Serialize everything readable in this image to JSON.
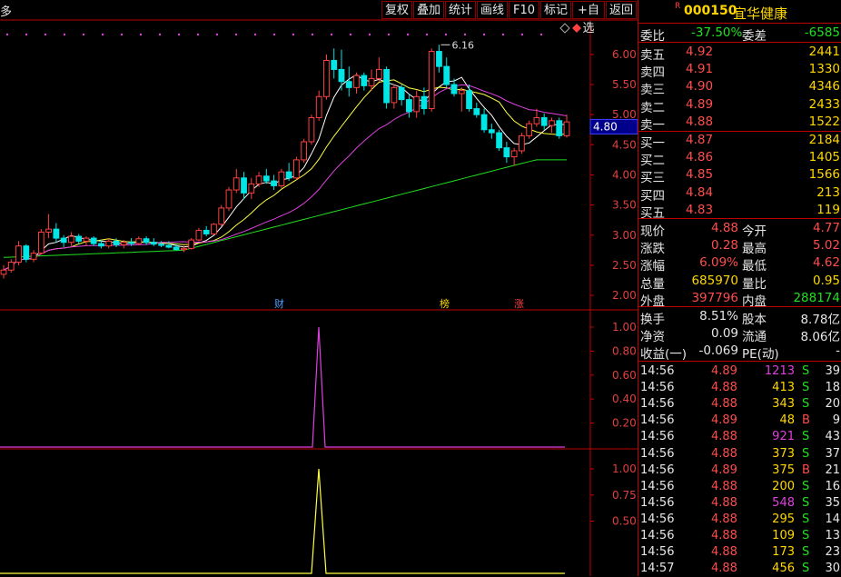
{
  "toolbar": {
    "menu_glyph": "多",
    "buttons": [
      "复权",
      "叠加",
      "统计",
      "画线",
      "F10",
      "标记",
      "+自选",
      "返回"
    ]
  },
  "chart": {
    "price_axis": [
      "6.00",
      "5.50",
      "5.00",
      "4.50",
      "4.00",
      "3.50",
      "3.00",
      "2.50",
      "2.00"
    ],
    "current_price_tag": "4.80",
    "high_label": "6.16",
    "markers": [
      "财",
      "榜",
      "涨"
    ],
    "ind1_axis": [
      "1.00",
      "0.80",
      "0.60",
      "0.40",
      "0.20"
    ],
    "ind2_axis": [
      "1.00",
      "0.75",
      "0.50"
    ],
    "colors": {
      "up": "#ff4040",
      "down": "#00e5e5",
      "ma5": "#ffffff",
      "ma10": "#ffff40",
      "ma20": "#e040e0",
      "ma60": "#20e020",
      "grid": "#c00000"
    }
  },
  "chart_data": {
    "type": "candlestick",
    "y_range": [
      1.85,
      6.3
    ],
    "candles": [
      {
        "o": 2.35,
        "h": 2.5,
        "l": 2.28,
        "c": 2.42
      },
      {
        "o": 2.42,
        "h": 2.6,
        "l": 2.38,
        "c": 2.55
      },
      {
        "o": 2.55,
        "h": 2.9,
        "l": 2.5,
        "c": 2.82
      },
      {
        "o": 2.82,
        "h": 2.85,
        "l": 2.55,
        "c": 2.6
      },
      {
        "o": 2.6,
        "h": 2.75,
        "l": 2.55,
        "c": 2.7
      },
      {
        "o": 2.7,
        "h": 3.1,
        "l": 2.68,
        "c": 3.05
      },
      {
        "o": 3.05,
        "h": 3.35,
        "l": 2.95,
        "c": 3.1
      },
      {
        "o": 3.1,
        "h": 3.2,
        "l": 2.88,
        "c": 2.95
      },
      {
        "o": 2.95,
        "h": 3.0,
        "l": 2.8,
        "c": 2.88
      },
      {
        "o": 2.88,
        "h": 3.05,
        "l": 2.82,
        "c": 2.98
      },
      {
        "o": 2.98,
        "h": 3.02,
        "l": 2.85,
        "c": 2.9
      },
      {
        "o": 2.9,
        "h": 2.98,
        "l": 2.82,
        "c": 2.95
      },
      {
        "o": 2.95,
        "h": 2.98,
        "l": 2.82,
        "c": 2.86
      },
      {
        "o": 2.86,
        "h": 2.92,
        "l": 2.78,
        "c": 2.82
      },
      {
        "o": 2.82,
        "h": 2.95,
        "l": 2.78,
        "c": 2.9
      },
      {
        "o": 2.9,
        "h": 2.95,
        "l": 2.8,
        "c": 2.84
      },
      {
        "o": 2.84,
        "h": 2.92,
        "l": 2.78,
        "c": 2.88
      },
      {
        "o": 2.88,
        "h": 2.95,
        "l": 2.82,
        "c": 2.86
      },
      {
        "o": 2.86,
        "h": 2.98,
        "l": 2.83,
        "c": 2.94
      },
      {
        "o": 2.94,
        "h": 2.98,
        "l": 2.84,
        "c": 2.88
      },
      {
        "o": 2.88,
        "h": 2.95,
        "l": 2.82,
        "c": 2.85
      },
      {
        "o": 2.85,
        "h": 2.9,
        "l": 2.8,
        "c": 2.83
      },
      {
        "o": 2.83,
        "h": 2.9,
        "l": 2.78,
        "c": 2.8
      },
      {
        "o": 2.8,
        "h": 2.86,
        "l": 2.74,
        "c": 2.76
      },
      {
        "o": 2.76,
        "h": 2.82,
        "l": 2.72,
        "c": 2.78
      },
      {
        "o": 2.78,
        "h": 2.95,
        "l": 2.76,
        "c": 2.92
      },
      {
        "o": 2.92,
        "h": 3.12,
        "l": 2.9,
        "c": 3.08
      },
      {
        "o": 3.08,
        "h": 3.15,
        "l": 2.98,
        "c": 3.02
      },
      {
        "o": 3.02,
        "h": 3.2,
        "l": 3.0,
        "c": 3.18
      },
      {
        "o": 3.18,
        "h": 3.5,
        "l": 3.15,
        "c": 3.45
      },
      {
        "o": 3.45,
        "h": 3.8,
        "l": 3.4,
        "c": 3.75
      },
      {
        "o": 3.75,
        "h": 4.1,
        "l": 3.7,
        "c": 3.95
      },
      {
        "o": 3.95,
        "h": 4.05,
        "l": 3.6,
        "c": 3.7
      },
      {
        "o": 3.7,
        "h": 3.95,
        "l": 3.6,
        "c": 3.85
      },
      {
        "o": 3.85,
        "h": 4.05,
        "l": 3.8,
        "c": 3.98
      },
      {
        "o": 3.98,
        "h": 4.1,
        "l": 3.85,
        "c": 3.9
      },
      {
        "o": 3.9,
        "h": 4.0,
        "l": 3.75,
        "c": 3.82
      },
      {
        "o": 3.82,
        "h": 4.1,
        "l": 3.78,
        "c": 4.05
      },
      {
        "o": 4.05,
        "h": 4.2,
        "l": 3.9,
        "c": 3.95
      },
      {
        "o": 3.95,
        "h": 4.3,
        "l": 3.92,
        "c": 4.25
      },
      {
        "o": 4.25,
        "h": 4.6,
        "l": 4.2,
        "c": 4.55
      },
      {
        "o": 4.55,
        "h": 5.0,
        "l": 4.5,
        "c": 4.95
      },
      {
        "o": 4.95,
        "h": 5.4,
        "l": 4.9,
        "c": 5.3
      },
      {
        "o": 5.3,
        "h": 6.0,
        "l": 5.25,
        "c": 5.9
      },
      {
        "o": 5.9,
        "h": 6.1,
        "l": 5.6,
        "c": 5.75
      },
      {
        "o": 5.75,
        "h": 6.08,
        "l": 5.4,
        "c": 5.55
      },
      {
        "o": 5.55,
        "h": 5.8,
        "l": 5.3,
        "c": 5.45
      },
      {
        "o": 5.45,
        "h": 5.7,
        "l": 5.35,
        "c": 5.65
      },
      {
        "o": 5.65,
        "h": 5.7,
        "l": 5.4,
        "c": 5.48
      },
      {
        "o": 5.48,
        "h": 5.75,
        "l": 5.4,
        "c": 5.6
      },
      {
        "o": 5.6,
        "h": 5.95,
        "l": 5.55,
        "c": 5.75
      },
      {
        "o": 5.75,
        "h": 5.8,
        "l": 5.1,
        "c": 5.2
      },
      {
        "o": 5.2,
        "h": 5.5,
        "l": 5.1,
        "c": 5.45
      },
      {
        "o": 5.45,
        "h": 5.5,
        "l": 5.15,
        "c": 5.25
      },
      {
        "o": 5.25,
        "h": 5.35,
        "l": 4.95,
        "c": 5.05
      },
      {
        "o": 5.05,
        "h": 5.4,
        "l": 4.95,
        "c": 5.3
      },
      {
        "o": 5.3,
        "h": 5.45,
        "l": 5.0,
        "c": 5.1
      },
      {
        "o": 5.1,
        "h": 6.1,
        "l": 5.05,
        "c": 6.05
      },
      {
        "o": 6.05,
        "h": 6.16,
        "l": 5.7,
        "c": 5.8
      },
      {
        "o": 5.8,
        "h": 5.95,
        "l": 5.45,
        "c": 5.5
      },
      {
        "o": 5.5,
        "h": 5.6,
        "l": 5.3,
        "c": 5.35
      },
      {
        "o": 5.35,
        "h": 5.45,
        "l": 5.05,
        "c": 5.4
      },
      {
        "o": 5.4,
        "h": 5.5,
        "l": 5.05,
        "c": 5.1
      },
      {
        "o": 5.1,
        "h": 5.2,
        "l": 4.95,
        "c": 5.0
      },
      {
        "o": 5.0,
        "h": 5.1,
        "l": 4.7,
        "c": 4.75
      },
      {
        "o": 4.75,
        "h": 4.85,
        "l": 4.6,
        "c": 4.7
      },
      {
        "o": 4.7,
        "h": 4.75,
        "l": 4.4,
        "c": 4.45
      },
      {
        "o": 4.45,
        "h": 4.55,
        "l": 4.2,
        "c": 4.3
      },
      {
        "o": 4.3,
        "h": 4.45,
        "l": 4.15,
        "c": 4.4
      },
      {
        "o": 4.4,
        "h": 4.7,
        "l": 4.35,
        "c": 4.65
      },
      {
        "o": 4.65,
        "h": 4.9,
        "l": 4.6,
        "c": 4.85
      },
      {
        "o": 4.85,
        "h": 5.1,
        "l": 4.8,
        "c": 4.95
      },
      {
        "o": 4.95,
        "h": 5.02,
        "l": 4.75,
        "c": 4.82
      },
      {
        "o": 4.82,
        "h": 4.95,
        "l": 4.7,
        "c": 4.9
      },
      {
        "o": 4.9,
        "h": 4.95,
        "l": 4.6,
        "c": 4.65
      },
      {
        "o": 4.65,
        "h": 5.0,
        "l": 4.62,
        "c": 4.88
      }
    ],
    "ind1_spike_value": 1.0,
    "ind2_spike_value": 1.0
  },
  "quote": {
    "flag": "R",
    "code": "000150",
    "name": "宜华健康",
    "weibi_label": "委比",
    "weibi_value": "-37.50%",
    "weicha_label": "委差",
    "weicha_value": "-6585",
    "asks": [
      {
        "label": "卖五",
        "price": "4.92",
        "vol": "2441"
      },
      {
        "label": "卖四",
        "price": "4.91",
        "vol": "1330"
      },
      {
        "label": "卖三",
        "price": "4.90",
        "vol": "4346"
      },
      {
        "label": "卖二",
        "price": "4.89",
        "vol": "2433"
      },
      {
        "label": "卖一",
        "price": "4.88",
        "vol": "1522"
      }
    ],
    "bids": [
      {
        "label": "买一",
        "price": "4.87",
        "vol": "2184"
      },
      {
        "label": "买二",
        "price": "4.86",
        "vol": "1405"
      },
      {
        "label": "买三",
        "price": "4.85",
        "vol": "1566"
      },
      {
        "label": "买四",
        "price": "4.84",
        "vol": "213"
      },
      {
        "label": "买五",
        "price": "4.83",
        "vol": "119"
      }
    ],
    "stats": [
      {
        "l1": "现价",
        "v1": "4.88",
        "c1": "red",
        "l2": "今开",
        "v2": "4.77",
        "c2": "red"
      },
      {
        "l1": "涨跌",
        "v1": "0.28",
        "c1": "red",
        "l2": "最高",
        "v2": "5.02",
        "c2": "red"
      },
      {
        "l1": "涨幅",
        "v1": "6.09%",
        "c1": "red",
        "l2": "最低",
        "v2": "4.62",
        "c2": "red"
      },
      {
        "l1": "总量",
        "v1": "685970",
        "c1": "yellow",
        "l2": "量比",
        "v2": "0.95",
        "c2": "yellow"
      },
      {
        "l1": "外盘",
        "v1": "397796",
        "c1": "red",
        "l2": "内盘",
        "v2": "288174",
        "c2": "green"
      }
    ],
    "stats2": [
      {
        "l1": "换手",
        "v1": "8.51%",
        "l2": "股本",
        "v2": "8.78亿"
      },
      {
        "l1": "净资",
        "v1": "0.09",
        "l2": "流通",
        "v2": "8.06亿"
      },
      {
        "l1": "收益(一)",
        "v1": "-0.069",
        "l2": "PE(动)",
        "v2": "-"
      }
    ],
    "ticks": [
      {
        "t": "14:56",
        "p": "4.89",
        "v": "1213",
        "vc": "magenta",
        "s": "S",
        "n": "39"
      },
      {
        "t": "14:56",
        "p": "4.88",
        "v": "413",
        "vc": "yellow",
        "s": "S",
        "n": "18"
      },
      {
        "t": "14:56",
        "p": "4.88",
        "v": "343",
        "vc": "yellow",
        "s": "S",
        "n": "20"
      },
      {
        "t": "14:56",
        "p": "4.89",
        "v": "48",
        "vc": "yellow",
        "s": "B",
        "n": "9"
      },
      {
        "t": "14:56",
        "p": "4.88",
        "v": "921",
        "vc": "magenta",
        "s": "S",
        "n": "43"
      },
      {
        "t": "14:56",
        "p": "4.88",
        "v": "373",
        "vc": "yellow",
        "s": "S",
        "n": "37"
      },
      {
        "t": "14:56",
        "p": "4.89",
        "v": "375",
        "vc": "yellow",
        "s": "B",
        "n": "21"
      },
      {
        "t": "14:56",
        "p": "4.88",
        "v": "200",
        "vc": "yellow",
        "s": "S",
        "n": "16"
      },
      {
        "t": "14:56",
        "p": "4.88",
        "v": "548",
        "vc": "magenta",
        "s": "S",
        "n": "35"
      },
      {
        "t": "14:56",
        "p": "4.88",
        "v": "295",
        "vc": "yellow",
        "s": "S",
        "n": "14"
      },
      {
        "t": "14:56",
        "p": "4.88",
        "v": "109",
        "vc": "yellow",
        "s": "S",
        "n": "13"
      },
      {
        "t": "14:56",
        "p": "4.88",
        "v": "173",
        "vc": "yellow",
        "s": "S",
        "n": "23"
      },
      {
        "t": "14:57",
        "p": "4.88",
        "v": "456",
        "vc": "yellow",
        "s": "S",
        "n": "30"
      }
    ]
  }
}
